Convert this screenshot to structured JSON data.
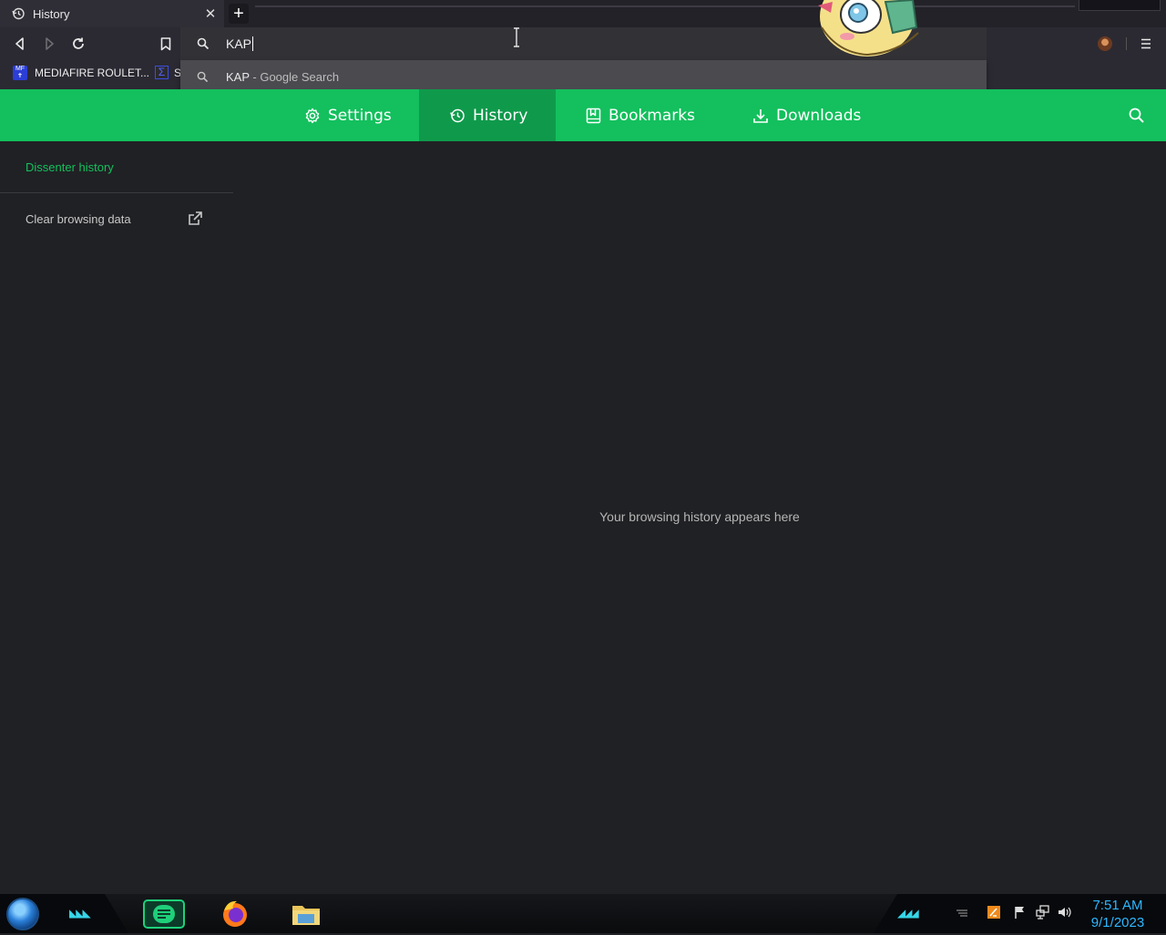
{
  "tab": {
    "title": "History"
  },
  "omnibox": {
    "query": "KAP"
  },
  "suggestion": {
    "main": "KAP",
    "sub": " - Google Search"
  },
  "bookmarks": [
    {
      "label": "MEDIAFIRE ROULET..."
    },
    {
      "label": "S"
    }
  ],
  "nav": {
    "settings": "Settings",
    "history": "History",
    "bookmarks": "Bookmarks",
    "downloads": "Downloads"
  },
  "sidebar": {
    "active_item": "Dissenter history",
    "clear_label": "Clear browsing data"
  },
  "main": {
    "empty_message": "Your browsing history appears here"
  },
  "taskbar": {
    "time": "7:51 AM",
    "date": "9/1/2023"
  },
  "colors": {
    "accent": "#13c05d",
    "accent_active": "#0f9a4b",
    "background": "#202124",
    "clock": "#2fb7ff"
  }
}
